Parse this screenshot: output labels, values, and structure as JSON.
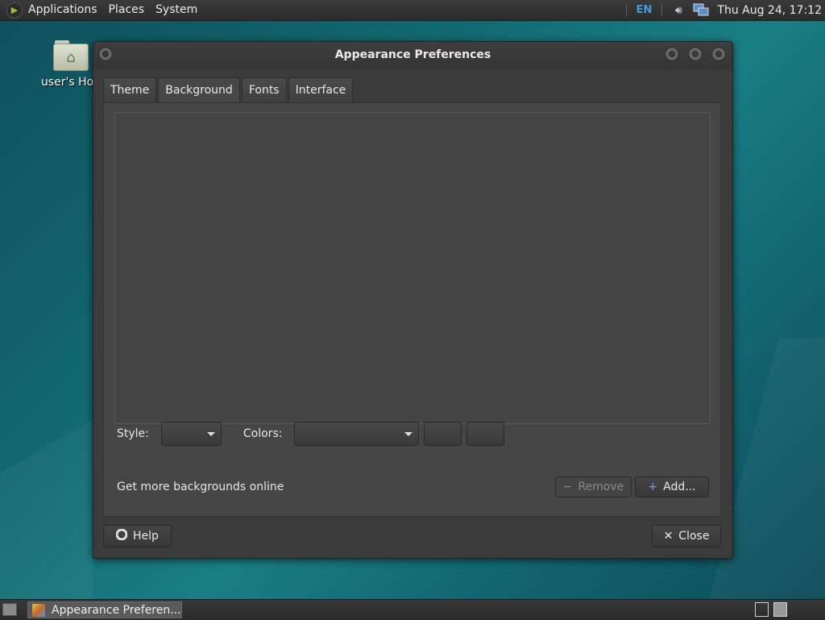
{
  "top_panel": {
    "menu": [
      "Applications",
      "Places",
      "System"
    ],
    "lang": "EN",
    "clock": "Thu Aug 24, 17:12"
  },
  "desktop": {
    "home_label": "user's Hon"
  },
  "window": {
    "title": "Appearance Preferences",
    "tabs": [
      "Theme",
      "Background",
      "Fonts",
      "Interface"
    ],
    "active_tab": "Background",
    "style_label": "Style:",
    "colors_label": "Colors:",
    "more_link": "Get more backgrounds online",
    "remove_label": "Remove",
    "add_label": "Add...",
    "help_label": "Help",
    "close_label": "Close"
  },
  "taskbar": {
    "task_label": "Appearance Preferen..."
  },
  "icons": {
    "remove": "minus-icon",
    "add": "plus-icon",
    "help": "help-lifebuoy-icon",
    "close": "close-x-icon"
  }
}
